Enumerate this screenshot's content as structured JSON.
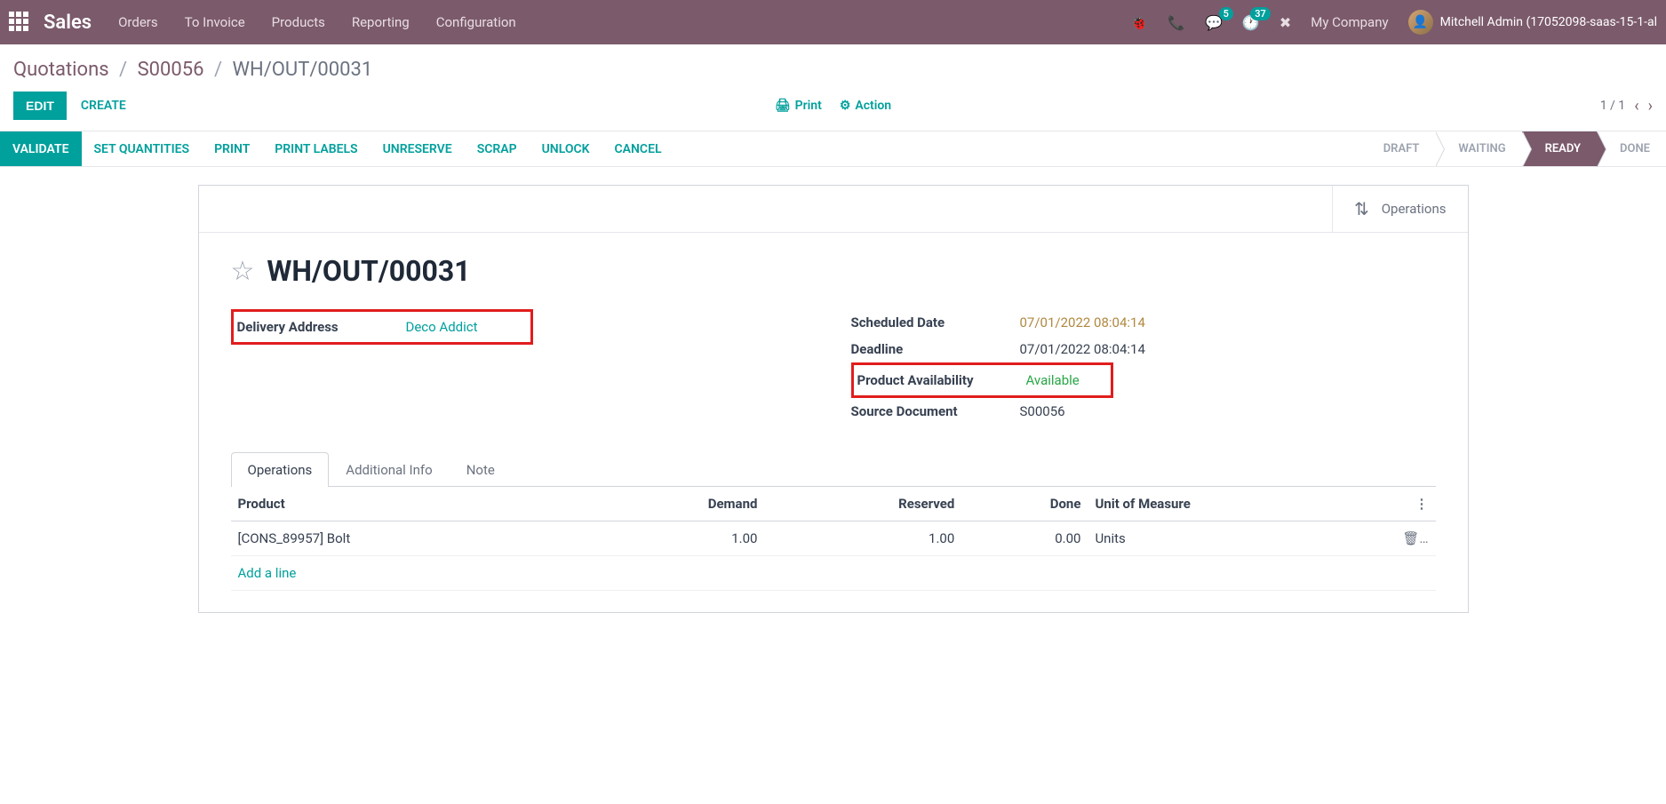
{
  "topnav": {
    "brand": "Sales",
    "menu": [
      "Orders",
      "To Invoice",
      "Products",
      "Reporting",
      "Configuration"
    ],
    "badges": {
      "messages": "5",
      "activities": "37"
    },
    "company": "My Company",
    "user": "Mitchell Admin (17052098-saas-15-1-al"
  },
  "breadcrumb": {
    "items": [
      "Quotations",
      "S00056"
    ],
    "current": "WH/OUT/00031"
  },
  "actions": {
    "edit": "EDIT",
    "create": "CREATE",
    "print": "Print",
    "action": "Action",
    "pager": "1 / 1"
  },
  "statusbar": {
    "buttons": [
      "VALIDATE",
      "SET QUANTITIES",
      "PRINT",
      "PRINT LABELS",
      "UNRESERVE",
      "SCRAP",
      "UNLOCK",
      "CANCEL"
    ],
    "stages": [
      "DRAFT",
      "WAITING",
      "READY",
      "DONE"
    ],
    "active_stage": 2
  },
  "buttonbox": {
    "operations": "Operations"
  },
  "record": {
    "title": "WH/OUT/00031",
    "left": {
      "delivery_address_label": "Delivery Address",
      "delivery_address": "Deco Addict"
    },
    "right": {
      "scheduled_label": "Scheduled Date",
      "scheduled": "07/01/2022 08:04:14",
      "deadline_label": "Deadline",
      "deadline": "07/01/2022 08:04:14",
      "availability_label": "Product Availability",
      "availability": "Available",
      "source_label": "Source Document",
      "source": "S00056"
    }
  },
  "tabs": [
    "Operations",
    "Additional Info",
    "Note"
  ],
  "table": {
    "headers": {
      "product": "Product",
      "demand": "Demand",
      "reserved": "Reserved",
      "done": "Done",
      "uom": "Unit of Measure"
    },
    "row": {
      "product": "[CONS_89957] Bolt",
      "demand": "1.00",
      "reserved": "1.00",
      "done": "0.00",
      "uom": "Units"
    },
    "add_line": "Add a line"
  }
}
